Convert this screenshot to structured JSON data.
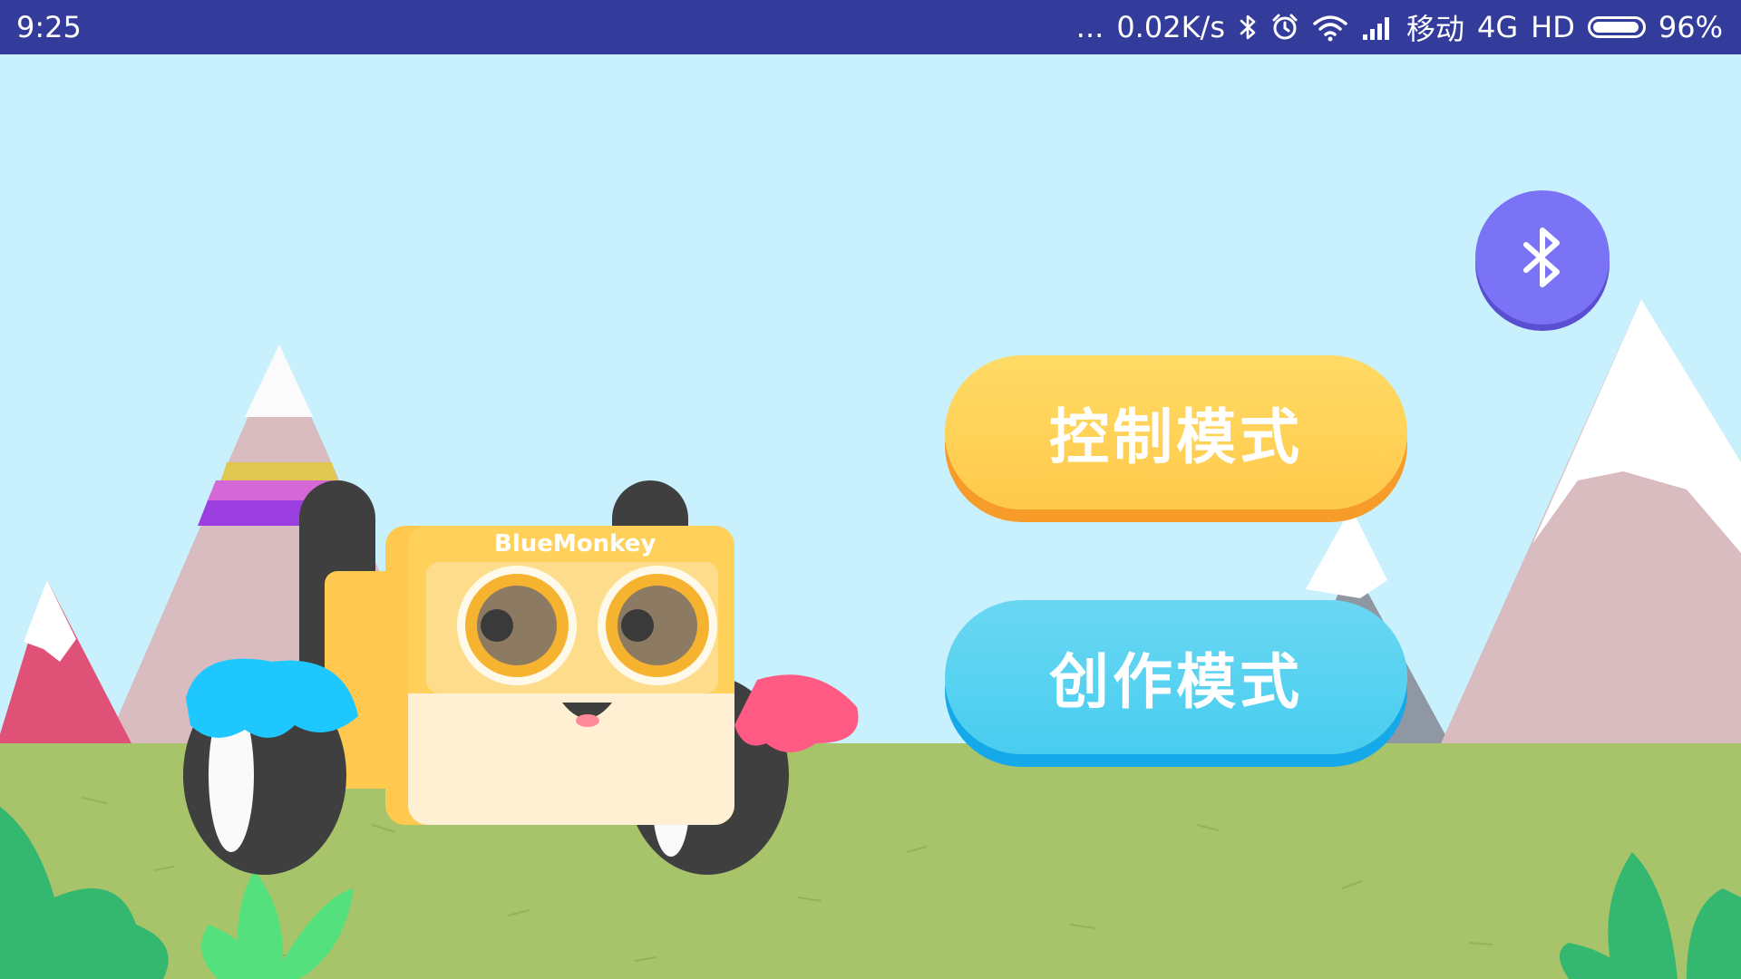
{
  "statusbar": {
    "time": "9:25",
    "more": "...",
    "net_speed": "0.02K/s",
    "carrier": "移动",
    "network": "4G",
    "hd": "HD",
    "battery": "96%",
    "battery_level": 0.96
  },
  "robot": {
    "brand_text": "BlueMonkey"
  },
  "buttons": {
    "control_mode": "控制模式",
    "create_mode": "创作模式"
  },
  "colors": {
    "statusbar_bg": "#333c9b",
    "sky": "#c8f1fd",
    "grass": "#a7c46a",
    "control_button": "#ffd257",
    "create_button": "#58d3f2",
    "bluetooth_button": "#7b73f5"
  },
  "icons": {
    "bluetooth": "bluetooth-icon",
    "alarm": "alarm-icon",
    "wifi": "wifi-icon",
    "signal": "signal-icon"
  }
}
